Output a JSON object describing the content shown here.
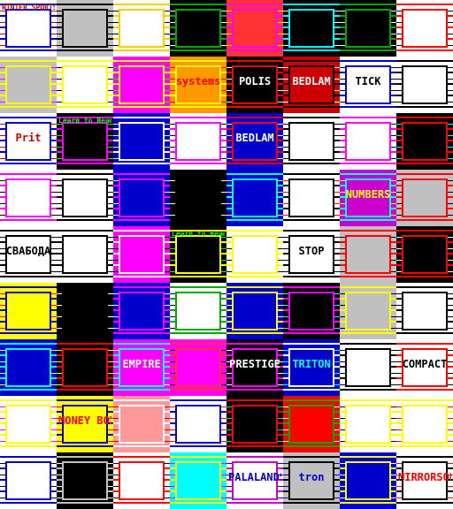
{
  "title_screens": [
    {
      "text": "WINTER SPORTS",
      "bg": "#ffffff",
      "fg": "#cc0000",
      "accent": "#0000cc"
    },
    {
      "text": "",
      "bg": "#c0c0c0",
      "fg": "#000000",
      "accent": "#000000"
    },
    {
      "text": "",
      "bg": "#ffffff",
      "fg": "#000000",
      "accent": "#ffcc00"
    },
    {
      "text": "",
      "bg": "#000000",
      "fg": "#ffffff",
      "accent": "#00aa00"
    },
    {
      "text": "",
      "bg": "#ff3333",
      "fg": "#ffff00",
      "accent": "#ff00ff"
    },
    {
      "text": "",
      "bg": "#000000",
      "fg": "#ffffff",
      "accent": "#00ffff"
    },
    {
      "text": "",
      "bg": "#000000",
      "fg": "#ffffff",
      "accent": "#00aa00"
    },
    {
      "text": "",
      "bg": "#ffffff",
      "fg": "#000000",
      "accent": "#ff0000"
    },
    {
      "text": "",
      "bg": "#c0c0c0",
      "fg": "#ff00ff",
      "accent": "#ffff00"
    },
    {
      "text": "",
      "bg": "#ffffff",
      "fg": "#000000",
      "accent": "#ffff00"
    },
    {
      "text": "",
      "bg": "#ff00ff",
      "fg": "#00ff00",
      "accent": "#ffff00"
    },
    {
      "text": "systems",
      "bg": "#ff9900",
      "fg": "#ff0000",
      "accent": "#ffff00"
    },
    {
      "text": "POLIS",
      "bg": "#000000",
      "fg": "#ffffff",
      "accent": "#ff0000"
    },
    {
      "text": "BEDLAM",
      "bg": "#cc0000",
      "fg": "#ffffff",
      "accent": "#000000"
    },
    {
      "text": "TICK",
      "bg": "#ffffff",
      "fg": "#000000",
      "accent": "#0000cc"
    },
    {
      "text": "",
      "bg": "#ffffff",
      "fg": "#000000",
      "accent": "#000000"
    },
    {
      "text": "Prit",
      "bg": "#ffffff",
      "fg": "#cc0000",
      "accent": "#0000cc"
    },
    {
      "text": "Learn to Read",
      "bg": "#000000",
      "fg": "#00ff00",
      "accent": "#ff00ff"
    },
    {
      "text": "",
      "bg": "#0000cc",
      "fg": "#ffff00",
      "accent": "#ffffff"
    },
    {
      "text": "",
      "bg": "#ffffff",
      "fg": "#000000",
      "accent": "#ff00ff"
    },
    {
      "text": "BEDLAM",
      "bg": "#0000cc",
      "fg": "#ffffff",
      "accent": "#ff0000"
    },
    {
      "text": "",
      "bg": "#ffffff",
      "fg": "#000000",
      "accent": "#000000"
    },
    {
      "text": "",
      "bg": "#ffffff",
      "fg": "#000000",
      "accent": "#ff00ff"
    },
    {
      "text": "",
      "bg": "#000000",
      "fg": "#00ffff",
      "accent": "#ff0000"
    },
    {
      "text": "",
      "bg": "#ffffff",
      "fg": "#000000",
      "accent": "#ff00ff"
    },
    {
      "text": "",
      "bg": "#ffffff",
      "fg": "#000000",
      "accent": "#000000"
    },
    {
      "text": "",
      "bg": "#0000cc",
      "fg": "#ffffff",
      "accent": "#ff00ff"
    },
    {
      "text": "",
      "bg": "#000000",
      "fg": "#ffffff",
      "accent": "#000000"
    },
    {
      "text": "",
      "bg": "#0000cc",
      "fg": "#ffff00",
      "accent": "#00ffff"
    },
    {
      "text": "",
      "bg": "#ffffff",
      "fg": "#ff0000",
      "accent": "#000000"
    },
    {
      "text": "NUMBERS",
      "bg": "#cc00cc",
      "fg": "#ffff00",
      "accent": "#00ffff"
    },
    {
      "text": "",
      "bg": "#c0c0c0",
      "fg": "#000000",
      "accent": "#ff0000"
    },
    {
      "text": "СВАБОДА",
      "bg": "#ffffff",
      "fg": "#000000",
      "accent": "#000000"
    },
    {
      "text": "",
      "bg": "#ffffff",
      "fg": "#000000",
      "accent": "#000000"
    },
    {
      "text": "",
      "bg": "#ff00ff",
      "fg": "#000000",
      "accent": "#ffffff"
    },
    {
      "text": "Learn to Read",
      "bg": "#000000",
      "fg": "#00ff00",
      "accent": "#ffff00"
    },
    {
      "text": "",
      "bg": "#ffffff",
      "fg": "#000000",
      "accent": "#ffff00"
    },
    {
      "text": "STOP",
      "bg": "#ffffff",
      "fg": "#000000",
      "accent": "#000000"
    },
    {
      "text": "",
      "bg": "#c0c0c0",
      "fg": "#000000",
      "accent": "#ff0000"
    },
    {
      "text": "",
      "bg": "#000000",
      "fg": "#ffffff",
      "accent": "#ff0000"
    },
    {
      "text": "",
      "bg": "#ffff00",
      "fg": "#ff0000",
      "accent": "#0000cc"
    },
    {
      "text": "",
      "bg": "#000000",
      "fg": "#ffffff",
      "accent": "#000000"
    },
    {
      "text": "",
      "bg": "#0000cc",
      "fg": "#ffffff",
      "accent": "#ff00ff"
    },
    {
      "text": "",
      "bg": "#ffffff",
      "fg": "#000000",
      "accent": "#00aa00"
    },
    {
      "text": "",
      "bg": "#0000cc",
      "fg": "#ffffff",
      "accent": "#ffff00"
    },
    {
      "text": "",
      "bg": "#000000",
      "fg": "#00ffff",
      "accent": "#ff00ff"
    },
    {
      "text": "",
      "bg": "#c0c0c0",
      "fg": "#000000",
      "accent": "#ffff00"
    },
    {
      "text": "",
      "bg": "#ffffff",
      "fg": "#000000",
      "accent": "#000000"
    },
    {
      "text": "",
      "bg": "#0000cc",
      "fg": "#ffff00",
      "accent": "#00ffff"
    },
    {
      "text": "",
      "bg": "#000000",
      "fg": "#ffff00",
      "accent": "#ff0000"
    },
    {
      "text": "EMPIRE",
      "bg": "#ff00ff",
      "fg": "#ffffff",
      "accent": "#00ffff"
    },
    {
      "text": "",
      "bg": "#ff00ff",
      "fg": "#000000",
      "accent": "#ff3333"
    },
    {
      "text": "PRESTIGE",
      "bg": "#000000",
      "fg": "#ffffff",
      "accent": "#ff00ff"
    },
    {
      "text": "TRITON",
      "bg": "#0000cc",
      "fg": "#00ffff",
      "accent": "#ffffff"
    },
    {
      "text": "",
      "bg": "#ffffff",
      "fg": "#000000",
      "accent": "#000000"
    },
    {
      "text": "COMPACT",
      "bg": "#ffffff",
      "fg": "#000000",
      "accent": "#ff0000"
    },
    {
      "text": "",
      "bg": "#ffffff",
      "fg": "#ff00ff",
      "accent": "#ffff00"
    },
    {
      "text": "MONEY BOX",
      "bg": "#ffff00",
      "fg": "#ff0000",
      "accent": "#0000cc"
    },
    {
      "text": "",
      "bg": "#ff9999",
      "fg": "#cc0000",
      "accent": "#ffffff"
    },
    {
      "text": "",
      "bg": "#ffffff",
      "fg": "#ff0000",
      "accent": "#0000cc"
    },
    {
      "text": "",
      "bg": "#000000",
      "fg": "#00ff00",
      "accent": "#ff0000"
    },
    {
      "text": "",
      "bg": "#ff0000",
      "fg": "#ffffff",
      "accent": "#00aa00"
    },
    {
      "text": "",
      "bg": "#ffffff",
      "fg": "#000000",
      "accent": "#ffff00"
    },
    {
      "text": "",
      "bg": "#ffffff",
      "fg": "#ff0000",
      "accent": "#ffff00"
    },
    {
      "text": "",
      "bg": "#ffffff",
      "fg": "#000000",
      "accent": "#0000cc"
    },
    {
      "text": "",
      "bg": "#000000",
      "fg": "#ffffff",
      "accent": "#c0c0c0"
    },
    {
      "text": "",
      "bg": "#ffffff",
      "fg": "#000000",
      "accent": "#ff0000"
    },
    {
      "text": "",
      "bg": "#00ffff",
      "fg": "#ff00ff",
      "accent": "#ffff00"
    },
    {
      "text": "PALALANDS",
      "bg": "#ffffff",
      "fg": "#0000cc",
      "accent": "#cc00cc"
    },
    {
      "text": "tron",
      "bg": "#c0c0c0",
      "fg": "#0000cc",
      "accent": "#000000"
    },
    {
      "text": "",
      "bg": "#0000cc",
      "fg": "#ffffff",
      "accent": "#ffff00"
    },
    {
      "text": "MIRRORSOFT",
      "bg": "#ffffff",
      "fg": "#ff0000",
      "accent": "#000000"
    }
  ]
}
